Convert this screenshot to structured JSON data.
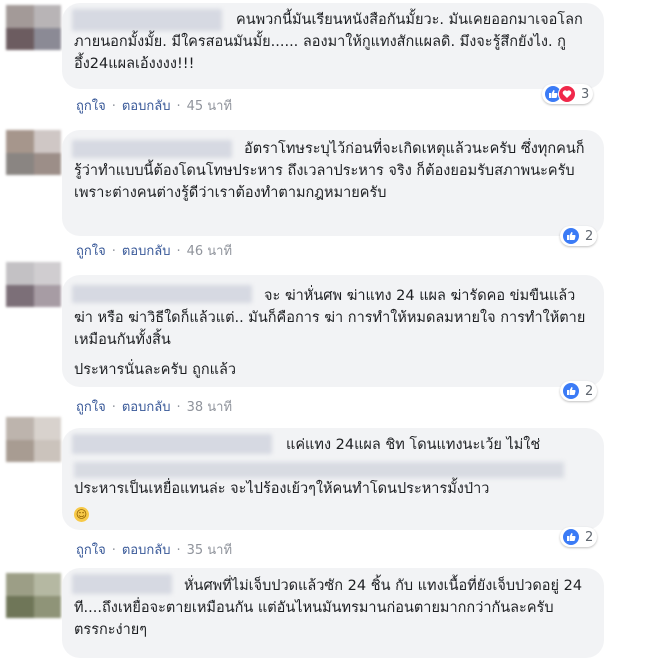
{
  "actions": {
    "like_label": "ถูกใจ",
    "reply_label": "ตอบกลับ",
    "separator": "·"
  },
  "comments": [
    {
      "text": "คนพวกนี้มันเรียนหนังสือกันมั้ยวะ. มันเคยออกมาเจอโลกภายนอกมั้งมั้ย. มีใครสอนมันมั้ย...... ลองมาให้กูแทงสักแผลดิ. มึงจะรู้สึกยังไง. กูอึ้ง24แผลเอ้งงงง!!!",
      "time": "45 นาที",
      "reaction_count": "3",
      "reactions": [
        "like-icon",
        "love-icon"
      ]
    },
    {
      "text": "อัตราโทษระบุไว้ก่อนที่จะเกิดเหตุแล้วนะครับ ซึ่งทุกคนก็รู้ว่าทำแบบนี้ต้องโดนโทษประหาร ถึงเวลาประหาร จริง ก็ต้องยอมรับสภาพนะครับ เพราะต่างคนต่างรู้ดีว่าเราต้องทำตามกฎหมายครับ",
      "time": "46 นาที",
      "reaction_count": "2",
      "reactions": [
        "like-icon"
      ]
    },
    {
      "text": "จะ ฆ่าหั่นศพ ฆ่าแทง 24 แผล ฆ่ารัดคอ ข่มขืนแล้วฆ่า หรือ ฆ่าวิธีใดก็แล้วแต่.. มันก็คือการ ฆ่า การทำให้หมดลมหายใจ การทำให้ตายเหมือนกันทั้งสิ้น",
      "text_extra": "ประหารนั่นละครับ ถูกแล้ว",
      "time": "38 นาที",
      "reaction_count": "2",
      "reactions": [
        "like-icon"
      ]
    },
    {
      "text": "แค่แทง 24แผล ชิท โดนแทงนะเว้ย ไม่ใช่",
      "text_line3": "ประหารเป็นเหยื่อแทนล่ะ จะไปร้องเย้วๆให้คนทำโดนประหารมั้งป่าว",
      "emoji": "smile-emoji",
      "time": "35 นาที",
      "reaction_count": "2",
      "reactions": [
        "like-icon"
      ]
    },
    {
      "text": "หั่นศพที่ไม่เจ็บปวดแล้วซัก 24 ชิ้น กับ แทงเนื้อที่ยังเจ็บปวดอยู่ 24 ที....ถึงเหยื่อจะตายเหมือนกัน แต่อันไหนมันทรมานก่อนตายมากกว่ากันละครับ ตรรกะง่ายๆ"
    }
  ],
  "colors": {
    "bubble": "#f2f3f5",
    "link": "#385898",
    "meta": "#90949c",
    "like": "#3b7bf6",
    "love": "#f0284a"
  }
}
